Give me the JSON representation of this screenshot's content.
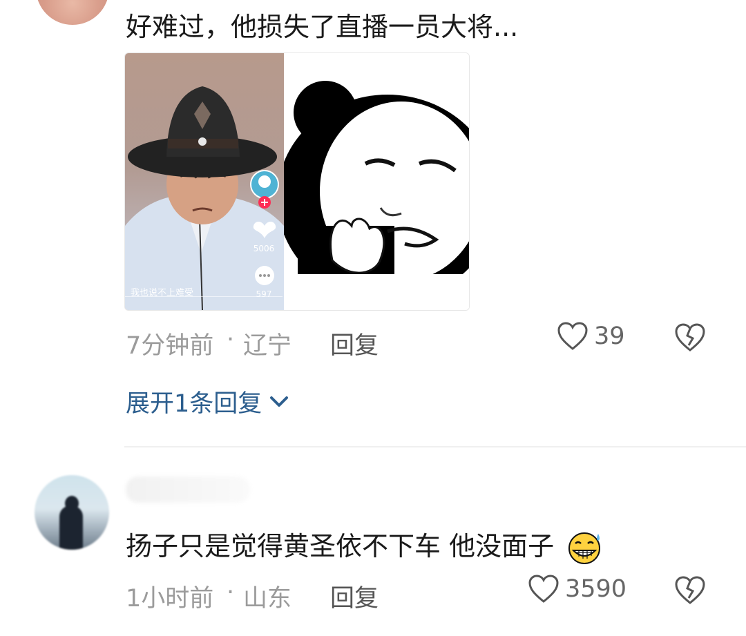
{
  "comment1": {
    "text": "好难过，他损失了直播一员大将...",
    "image": {
      "caption": "我也说不上难受",
      "like_count": "5006",
      "comment_count": "597"
    },
    "time": "7分钟前",
    "separator": "·",
    "location": "辽宁",
    "reply_label": "回复",
    "likes": "39"
  },
  "expand_replies": {
    "label": "展开1条回复"
  },
  "comment2": {
    "text": "扬子只是觉得黄圣依不下车 他没面子",
    "time": "1小时前",
    "separator": "·",
    "location": "山东",
    "reply_label": "回复",
    "likes": "3590"
  },
  "colors": {
    "link_blue": "#2c5e8e",
    "meta_gray": "#9b9b9b",
    "text_dark": "#1a1a1a",
    "accent_pink": "#fe2c55"
  }
}
